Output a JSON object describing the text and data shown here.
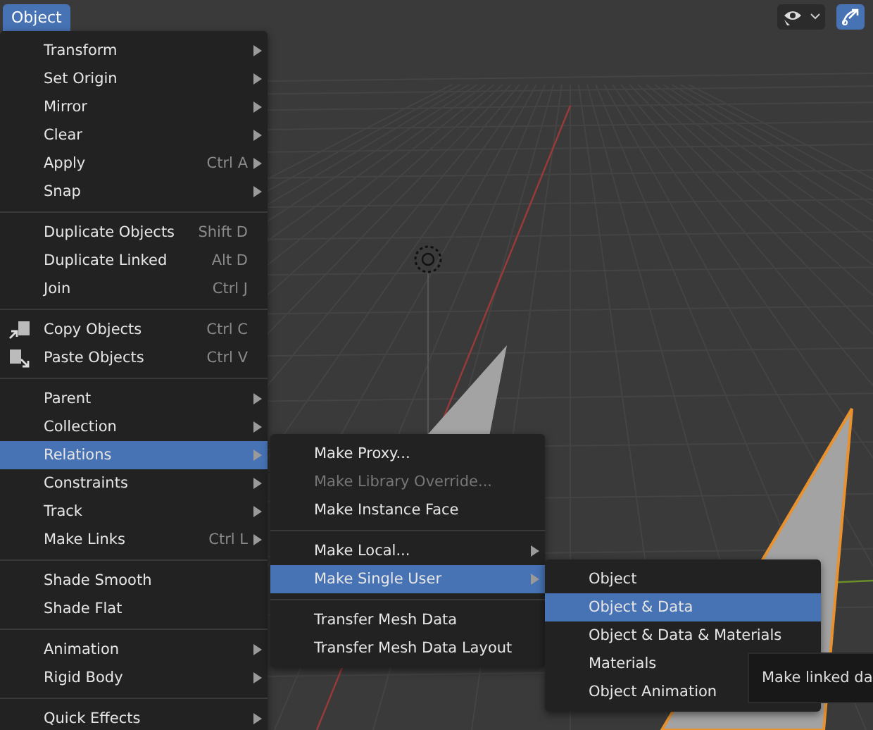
{
  "header_button": {
    "label": "Object",
    "selected": true
  },
  "menus": [
    {
      "groups": [
        [
          {
            "kind": "text",
            "label": "Transform",
            "submenu": true,
            "selected": false,
            "disabled": false
          },
          {
            "kind": "text",
            "label": "Set Origin",
            "submenu": true,
            "selected": false,
            "disabled": false
          },
          {
            "kind": "text",
            "label": "Mirror",
            "submenu": true,
            "selected": false,
            "disabled": false
          },
          {
            "kind": "text",
            "label": "Clear",
            "submenu": true,
            "selected": false,
            "disabled": false
          },
          {
            "kind": "text",
            "label": "Apply",
            "shortcut": "Ctrl A",
            "submenu": true,
            "selected": false,
            "disabled": false
          },
          {
            "kind": "text",
            "label": "Snap",
            "submenu": true,
            "selected": false,
            "disabled": false
          }
        ],
        [
          {
            "kind": "text",
            "label": "Duplicate Objects",
            "shortcut": "Shift D",
            "submenu": false,
            "selected": false,
            "disabled": false
          },
          {
            "kind": "text",
            "label": "Duplicate Linked",
            "shortcut": "Alt D",
            "submenu": false,
            "selected": false,
            "disabled": false
          },
          {
            "kind": "text",
            "label": "Join",
            "shortcut": "Ctrl J",
            "submenu": false,
            "selected": false,
            "disabled": false
          }
        ],
        [
          {
            "kind": "copy",
            "label": "Copy Objects",
            "shortcut": "Ctrl C",
            "submenu": false,
            "selected": false,
            "disabled": false
          },
          {
            "kind": "paste",
            "label": "Paste Objects",
            "shortcut": "Ctrl V",
            "submenu": false,
            "selected": false,
            "disabled": false
          }
        ],
        [
          {
            "kind": "text",
            "label": "Parent",
            "submenu": true,
            "selected": false,
            "disabled": false
          },
          {
            "kind": "text",
            "label": "Collection",
            "submenu": true,
            "selected": false,
            "disabled": false
          },
          {
            "kind": "text",
            "label": "Relations",
            "submenu": true,
            "selected": true,
            "disabled": false
          },
          {
            "kind": "text",
            "label": "Constraints",
            "submenu": true,
            "selected": false,
            "disabled": false
          },
          {
            "kind": "text",
            "label": "Track",
            "submenu": true,
            "selected": false,
            "disabled": false
          },
          {
            "kind": "text",
            "label": "Make Links",
            "shortcut": "Ctrl L",
            "submenu": true,
            "selected": false,
            "disabled": false
          }
        ],
        [
          {
            "kind": "text",
            "label": "Shade Smooth",
            "submenu": false,
            "selected": false,
            "disabled": false
          },
          {
            "kind": "text",
            "label": "Shade Flat",
            "submenu": false,
            "selected": false,
            "disabled": false
          }
        ],
        [
          {
            "kind": "text",
            "label": "Animation",
            "submenu": true,
            "selected": false,
            "disabled": false
          },
          {
            "kind": "text",
            "label": "Rigid Body",
            "submenu": true,
            "selected": false,
            "disabled": false
          }
        ],
        [
          {
            "kind": "text",
            "label": "Quick Effects",
            "submenu": true,
            "selected": false,
            "disabled": false
          }
        ]
      ]
    },
    {
      "groups": [
        [
          {
            "kind": "text",
            "label": "Make Proxy...",
            "submenu": false,
            "selected": false,
            "disabled": false
          },
          {
            "kind": "text",
            "label": "Make Library Override...",
            "submenu": false,
            "selected": false,
            "disabled": true
          },
          {
            "kind": "text",
            "label": "Make Instance Face",
            "submenu": false,
            "selected": false,
            "disabled": false
          }
        ],
        [
          {
            "kind": "text",
            "label": "Make Local...",
            "submenu": true,
            "selected": false,
            "disabled": false
          },
          {
            "kind": "text",
            "label": "Make Single User",
            "submenu": true,
            "selected": true,
            "disabled": false
          }
        ],
        [
          {
            "kind": "text",
            "label": "Transfer Mesh Data",
            "submenu": false,
            "selected": false,
            "disabled": false
          },
          {
            "kind": "text",
            "label": "Transfer Mesh Data Layout",
            "submenu": false,
            "selected": false,
            "disabled": false
          }
        ]
      ]
    },
    {
      "groups": [
        [
          {
            "kind": "text",
            "label": "Object",
            "submenu": false,
            "selected": false,
            "disabled": false
          },
          {
            "kind": "text",
            "label": "Object & Data",
            "submenu": false,
            "selected": true,
            "disabled": false
          },
          {
            "kind": "text",
            "label": "Object & Data & Materials",
            "submenu": false,
            "selected": false,
            "disabled": false
          },
          {
            "kind": "text",
            "label": "Materials",
            "submenu": false,
            "selected": false,
            "disabled": false
          },
          {
            "kind": "text",
            "label": "Object Animation",
            "submenu": false,
            "selected": false,
            "disabled": false
          }
        ]
      ]
    }
  ],
  "tooltip": {
    "text": "Make linked da"
  }
}
